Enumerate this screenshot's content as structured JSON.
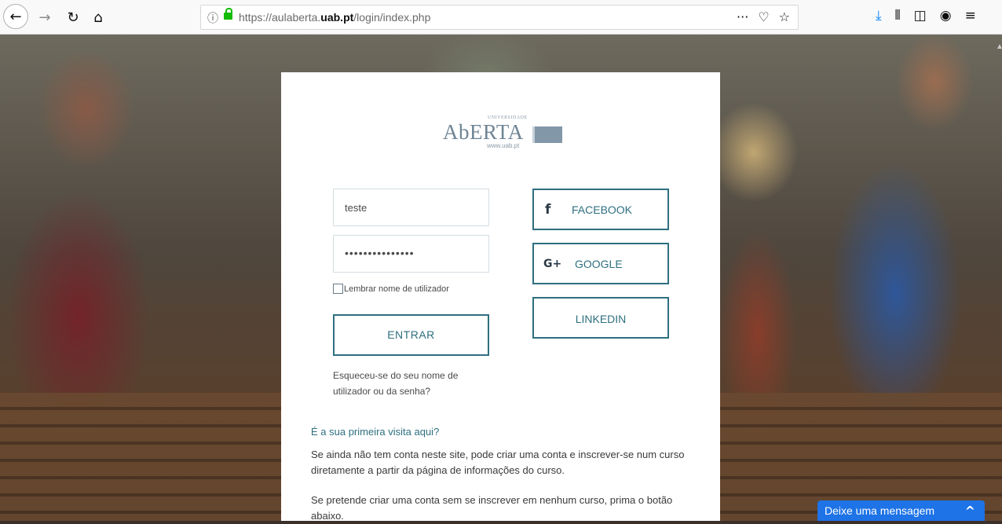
{
  "browser": {
    "url_prefix": "https://aulaberta.",
    "url_domain": "uab.pt",
    "url_path": "/login/index.php",
    "icons": [
      "back-icon",
      "forward-icon",
      "reload-icon",
      "home-icon",
      "info-icon",
      "lock-icon",
      "more-icon",
      "pocket-icon",
      "bookmark-star-icon",
      "download-icon",
      "library-icon",
      "sidebar-icon",
      "account-icon",
      "menu-icon"
    ]
  },
  "logo": {
    "small": "UNIVERSIDADE",
    "main": "AbERTA",
    "url": "www.uab.pt"
  },
  "login": {
    "username_value": "teste",
    "password_value": "•••••••••••••••",
    "remember_label": "Lembrar nome de utilizador",
    "submit_label": "ENTRAR",
    "forgot_text": "Esqueceu-se do seu nome de utilizador ou da senha?"
  },
  "social": {
    "facebook": "FACEBOOK",
    "google": "GOOGLE",
    "linkedin": "LINKEDIN",
    "facebook_glyph": "f",
    "google_glyph": "G+"
  },
  "first_visit": {
    "heading": "É a sua primeira visita aqui?",
    "para1": "Se ainda não tem conta neste site, pode criar uma conta e inscrever-se num curso diretamente a partir da página de informações do curso.",
    "para2": "Se pretende criar uma conta sem se inscrever em nenhum curso, prima o botão abaixo."
  },
  "chat": {
    "label": "Deixe uma mensagem"
  },
  "colors": {
    "accent": "#2e6f7f",
    "chat": "#1e73e6"
  }
}
